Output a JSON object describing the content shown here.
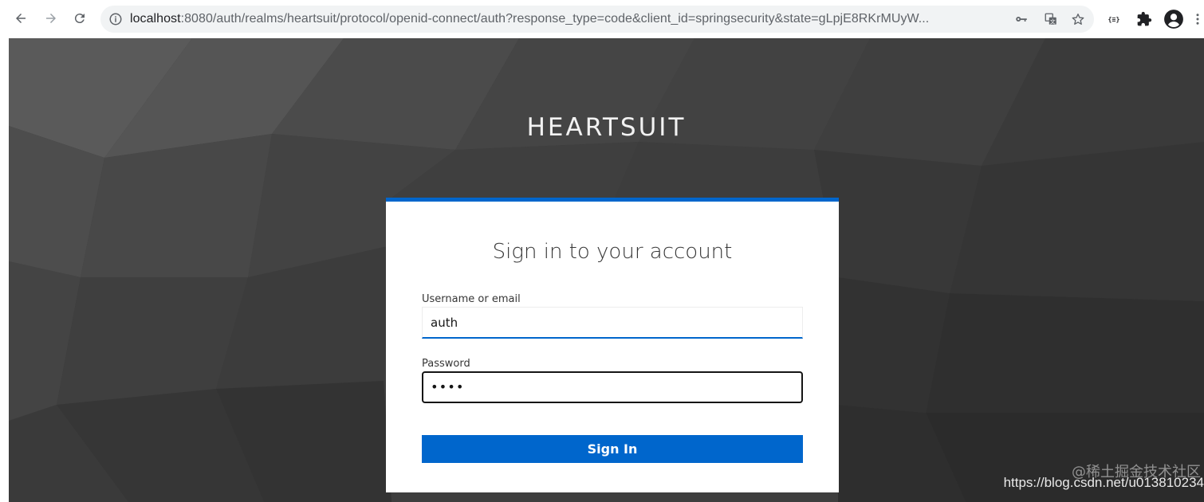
{
  "browser": {
    "url_host": "localhost",
    "url_rest": ":8080/auth/realms/heartsuit/protocol/openid-connect/auth?response_type=code&client_id=springsecurity&state=gLpjE8RKrMUyW...",
    "icons": [
      "back-icon",
      "forward-icon",
      "reload-icon",
      "info-icon",
      "key-icon",
      "translate-icon",
      "star-icon",
      "extension-json-icon",
      "puzzle-icon",
      "profile-icon",
      "more-icon"
    ]
  },
  "login": {
    "brand": "HEARTSUIT",
    "title": "Sign in to your account",
    "username_label": "Username or email",
    "username_value": "auth",
    "password_label": "Password",
    "password_value": "••••",
    "signin_label": "Sign In"
  },
  "watermark": {
    "cn": "@稀土掘金技术社区",
    "url": "https://blog.csdn.net/u013810234"
  },
  "colors": {
    "accent": "#0066cc",
    "background": "#3d3d3d"
  }
}
